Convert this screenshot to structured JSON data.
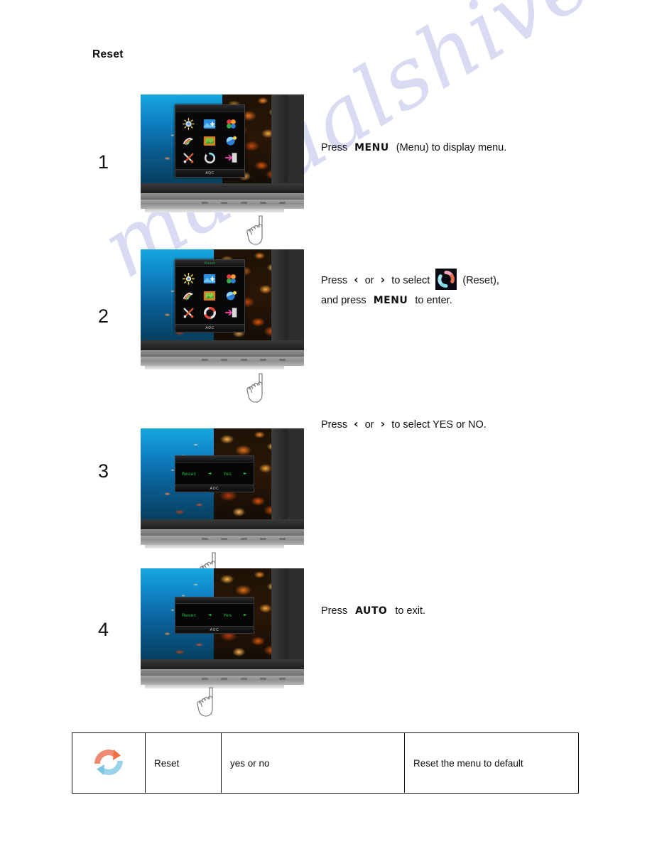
{
  "page": {
    "title": "Reset",
    "watermark": "manualshive.com"
  },
  "osd": {
    "menu_title": "Reset",
    "brand": "AOC",
    "dialog": {
      "label": "Reset",
      "left_arrow": "◄",
      "value": "Yes",
      "right_arrow": "►"
    },
    "grid_icons": [
      "luminance-icon",
      "image-setup-icon",
      "color-temperature-icon",
      "picture-boost-icon",
      "osd-setup-icon",
      "extra-icon",
      "tools-icon",
      "reset-icon",
      "exit-icon"
    ]
  },
  "steps": [
    {
      "number": "1",
      "text_parts": {
        "lead": "Press",
        "key": "MENU",
        "tail": "(Menu) to display menu."
      }
    },
    {
      "number": "2",
      "text_parts": {
        "lead": "Press",
        "left_chevron": "‹",
        "or": "or",
        "right_chevron": "›",
        "mid": "to select",
        "icon_label": "(Reset),",
        "line2_lead": "and press",
        "line2_key": "MENU",
        "line2_tail": "to enter."
      }
    },
    {
      "number": "3",
      "text_parts": {
        "lead": "Press",
        "left_chevron": "‹",
        "or": "or",
        "right_chevron": "›",
        "tail": "to select YES or NO."
      }
    },
    {
      "number": "4",
      "text_parts": {
        "lead": "Press",
        "key": "AUTO",
        "tail": "to exit."
      }
    }
  ],
  "table": {
    "rows": [
      {
        "icon": "reset-circular-arrows-icon",
        "name": "Reset",
        "value": "yes or no",
        "description": "Reset the menu to default"
      }
    ]
  },
  "colors": {
    "osd_green": "#24c23c",
    "reset_orange": "#ef7a5c",
    "reset_blue": "#7ec8e3",
    "watermark": "#b9bfe6"
  }
}
